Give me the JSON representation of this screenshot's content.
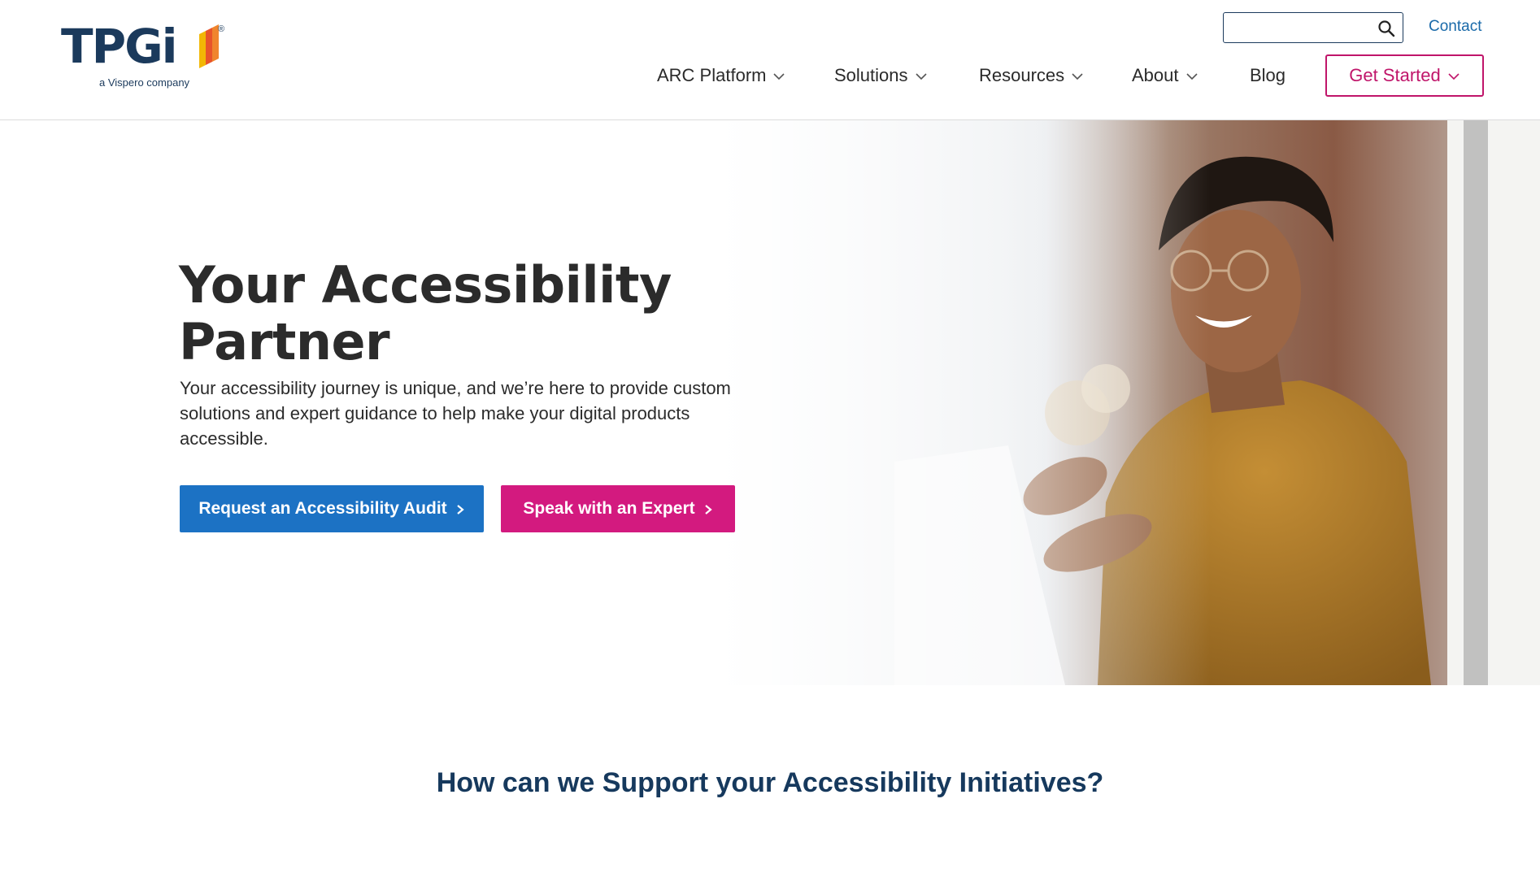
{
  "logo": {
    "wordmark": "TPGi",
    "tagline": "a Vispero company",
    "registered": "®"
  },
  "header": {
    "search_placeholder": "",
    "search_icon": "search-icon",
    "contact_label": "Contact"
  },
  "nav": {
    "items": [
      {
        "label": "ARC Platform",
        "has_dropdown": true
      },
      {
        "label": "Solutions",
        "has_dropdown": true
      },
      {
        "label": "Resources",
        "has_dropdown": true
      },
      {
        "label": "About",
        "has_dropdown": true
      },
      {
        "label": "Blog",
        "has_dropdown": false
      }
    ],
    "cta_label": "Get Started"
  },
  "hero": {
    "title_line1": "Your Accessibility",
    "title_line2": "Partner",
    "description": "Your accessibility journey is unique, and we’re here to provide custom solutions and expert guidance to help make your digital products accessible.",
    "primary_button": "Request an Accessibility Audit",
    "secondary_button": "Speak with an Expert"
  },
  "section": {
    "heading": "How can we Support your Accessibility Initiatives?"
  },
  "colors": {
    "brand_navy": "#1b3a5c",
    "link_blue": "#1a6aa9",
    "primary_blue": "#1c72c4",
    "accent_magenta": "#d31a7f",
    "cta_border": "#c0156a"
  }
}
